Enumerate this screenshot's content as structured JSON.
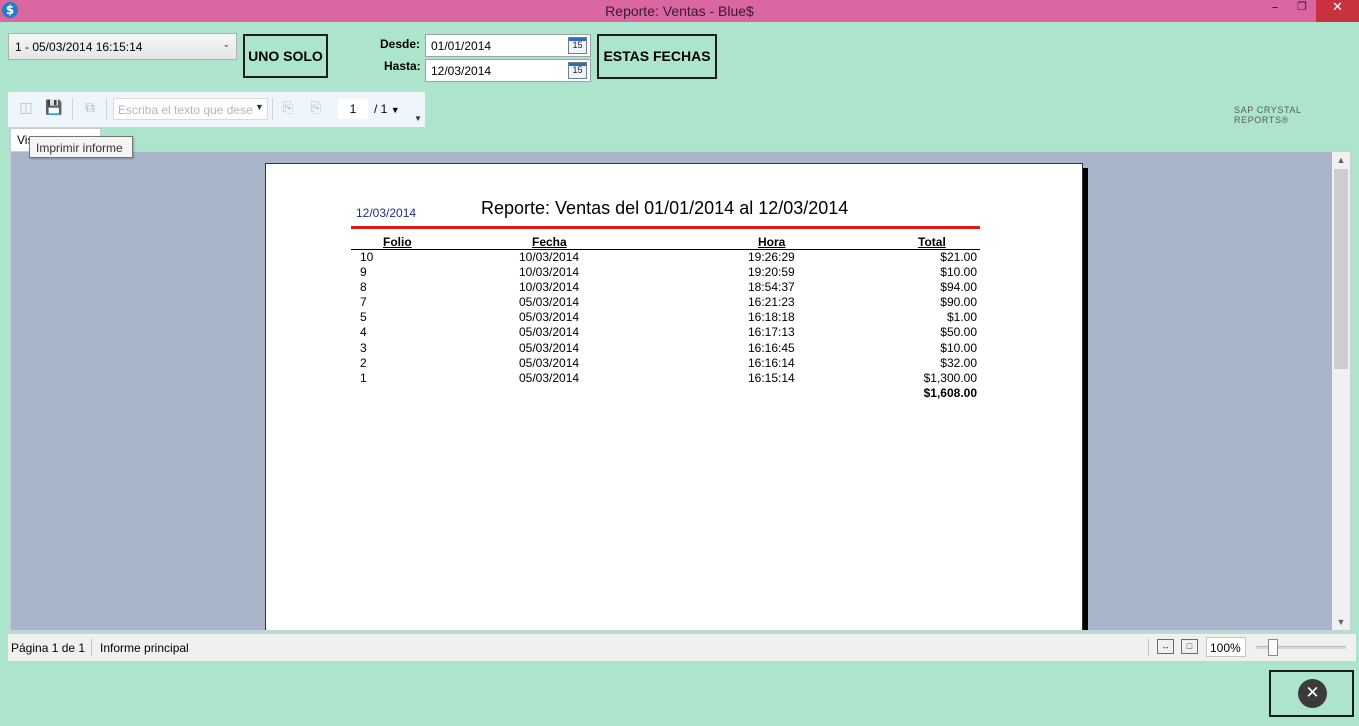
{
  "window": {
    "title": "Reporte: Ventas - Blue$",
    "app_icon": "$",
    "min_glyph": "–",
    "max_glyph": "❐",
    "close_glyph": "✕"
  },
  "controls": {
    "sale_select": "1 - 05/03/2014 16:15:14",
    "uno_solo_label": "UNO SOLO",
    "desde_label": "Desde:",
    "hasta_label": "Hasta:",
    "desde_value": "01/01/2014",
    "hasta_value": "12/03/2014",
    "calendar_day": "15",
    "estas_fechas_label": "ESTAS FECHAS"
  },
  "toolbar": {
    "search_placeholder": "Escriba el texto que dese",
    "current_page": "1",
    "total_pages": "/ 1",
    "brand": "SAP CRYSTAL REPORTS®",
    "icons": [
      "export-icon",
      "save-icon",
      "copy-icon",
      "search-dropdown-icon",
      "previous-page-icon",
      "next-page-icon",
      "page-dropdown-icon",
      "overflow-icon"
    ]
  },
  "tab": {
    "label": "Vis",
    "tooltip": "Imprimir informe"
  },
  "report": {
    "date": "12/03/2014",
    "title": "Reporte: Ventas del 01/01/2014 al 12/03/2014",
    "columns": [
      "Folio",
      "Fecha",
      "Hora",
      "Total"
    ],
    "rows": [
      {
        "folio": "10",
        "fecha": "10/03/2014",
        "hora": "19:26:29",
        "total": "$21.00"
      },
      {
        "folio": "9",
        "fecha": "10/03/2014",
        "hora": "19:20:59",
        "total": "$10.00"
      },
      {
        "folio": "8",
        "fecha": "10/03/2014",
        "hora": "18:54:37",
        "total": "$94.00"
      },
      {
        "folio": "7",
        "fecha": "05/03/2014",
        "hora": "16:21:23",
        "total": "$90.00"
      },
      {
        "folio": "5",
        "fecha": "05/03/2014",
        "hora": "16:18:18",
        "total": "$1.00"
      },
      {
        "folio": "4",
        "fecha": "05/03/2014",
        "hora": "16:17:13",
        "total": "$50.00"
      },
      {
        "folio": "3",
        "fecha": "05/03/2014",
        "hora": "16:16:45",
        "total": "$10.00"
      },
      {
        "folio": "2",
        "fecha": "05/03/2014",
        "hora": "16:16:14",
        "total": "$32.00"
      },
      {
        "folio": "1",
        "fecha": "05/03/2014",
        "hora": "16:15:14",
        "total": "$1,300.00"
      }
    ],
    "grand_total": "$1,608.00"
  },
  "status": {
    "page_info": "Página 1 de 1",
    "report_name": "Informe principal",
    "zoom": "100%",
    "zoom_level": 0.15
  },
  "colors": {
    "titlebar": "#d966a0",
    "background": "#ade5cc",
    "viewer_bg": "#a9b5cb",
    "report_rule": "#e01818",
    "report_date": "#1f2f8a",
    "close_button": "#c7323e"
  }
}
